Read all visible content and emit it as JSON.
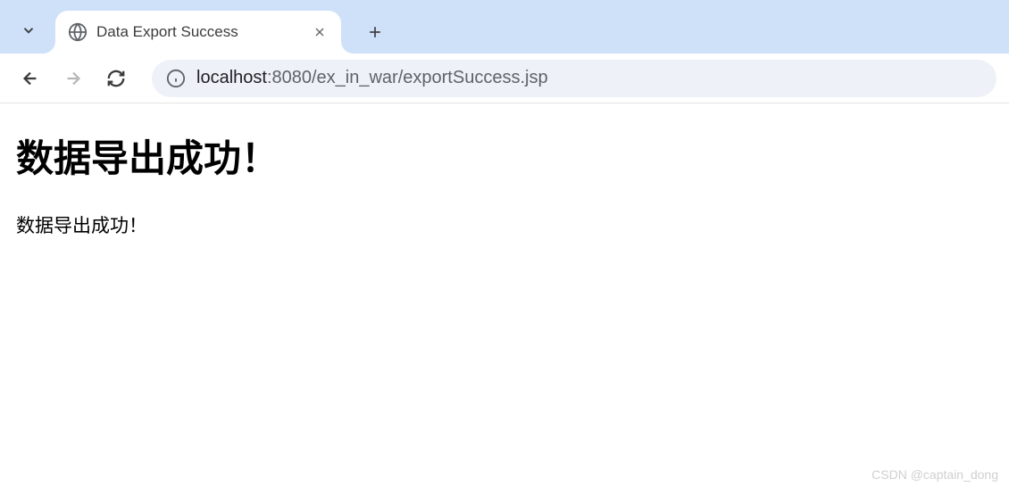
{
  "browser": {
    "tab": {
      "title": "Data Export Success"
    },
    "url": {
      "host": "localhost",
      "port": ":8080",
      "path": "/ex_in_war/exportSuccess.jsp"
    }
  },
  "page": {
    "heading": "数据导出成功！",
    "message": "数据导出成功！"
  },
  "watermark": "CSDN @captain_dong"
}
